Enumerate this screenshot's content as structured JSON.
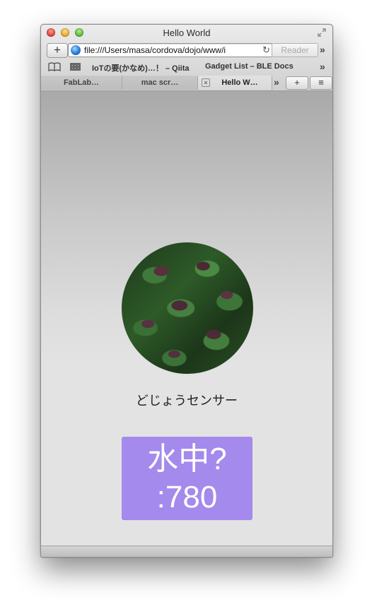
{
  "window": {
    "title": "Hello World"
  },
  "navbar": {
    "add_label": "+",
    "url": "file:///Users/masa/cordova/dojo/www/i",
    "reload_glyph": "↻",
    "reader_label": "Reader",
    "overflow_glyph": "»"
  },
  "bookmarks": {
    "items": [
      {
        "label": "IoTの要(かなめ)…！ – Qiita"
      },
      {
        "label": "Gadget List – BLE Docs"
      }
    ],
    "overflow_glyph": "»"
  },
  "tabs": {
    "items": [
      {
        "label": "FabLab…",
        "active": false
      },
      {
        "label": "mac scr…",
        "active": false
      },
      {
        "label": "Hello W…",
        "active": true
      }
    ],
    "overflow_glyph": "»",
    "new_tab_glyph": "+",
    "list_glyph": "≡"
  },
  "page": {
    "sensor_name": "どじょうセンサー",
    "status_line1": "水中?",
    "status_line2": ":780",
    "status_color": "#a48aec"
  }
}
